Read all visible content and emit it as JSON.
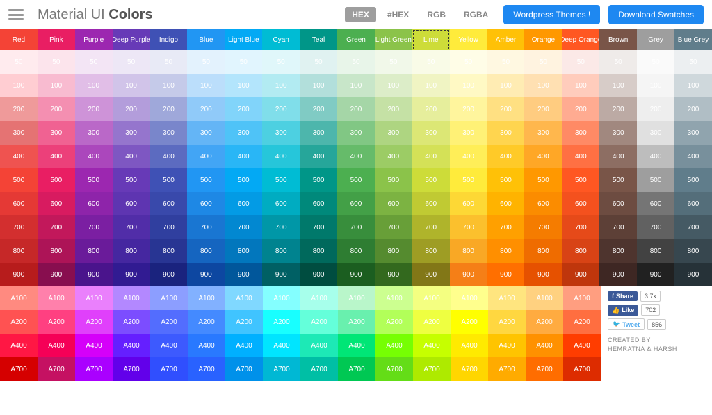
{
  "header": {
    "title_prefix": "Material UI ",
    "title_bold": "Colors",
    "formats": [
      {
        "label": "HEX",
        "active": true
      },
      {
        "label": "#HEX",
        "active": false
      },
      {
        "label": "RGB",
        "active": false
      },
      {
        "label": "RGBA",
        "active": false
      }
    ],
    "wp_button": "Wordpress Themes !",
    "dl_button": "Download Swatches"
  },
  "hues": [
    {
      "name": "Red",
      "shades": {
        "500": "#f44336",
        "50": "#ffebee",
        "100": "#ffcdd2",
        "200": "#ef9a9a",
        "300": "#e57373",
        "400": "#ef5350",
        "600": "#e53935",
        "700": "#d32f2f",
        "800": "#c62828",
        "900": "#b71c1c",
        "A100": "#ff8a80",
        "A200": "#ff5252",
        "A400": "#ff1744",
        "A700": "#d50000"
      }
    },
    {
      "name": "Pink",
      "shades": {
        "500": "#e91e63",
        "50": "#fce4ec",
        "100": "#f8bbd0",
        "200": "#f48fb1",
        "300": "#f06292",
        "400": "#ec407a",
        "600": "#d81b60",
        "700": "#c2185b",
        "800": "#ad1457",
        "900": "#880e4f",
        "A100": "#ff80ab",
        "A200": "#ff4081",
        "A400": "#f50057",
        "A700": "#c51162"
      }
    },
    {
      "name": "Purple",
      "shades": {
        "500": "#9c27b0",
        "50": "#f3e5f5",
        "100": "#e1bee7",
        "200": "#ce93d8",
        "300": "#ba68c8",
        "400": "#ab47bc",
        "600": "#8e24aa",
        "700": "#7b1fa2",
        "800": "#6a1b9a",
        "900": "#4a148c",
        "A100": "#ea80fc",
        "A200": "#e040fb",
        "A400": "#d500f9",
        "A700": "#aa00ff"
      }
    },
    {
      "name": "Deep Purple",
      "shades": {
        "500": "#673ab7",
        "50": "#ede7f6",
        "100": "#d1c4e9",
        "200": "#b39ddb",
        "300": "#9575cd",
        "400": "#7e57c2",
        "600": "#5e35b1",
        "700": "#512da8",
        "800": "#4527a0",
        "900": "#311b92",
        "A100": "#b388ff",
        "A200": "#7c4dff",
        "A400": "#651fff",
        "A700": "#6200ea"
      }
    },
    {
      "name": "Indigo",
      "shades": {
        "500": "#3f51b5",
        "50": "#e8eaf6",
        "100": "#c5cae9",
        "200": "#9fa8da",
        "300": "#7986cb",
        "400": "#5c6bc0",
        "600": "#3949ab",
        "700": "#303f9f",
        "800": "#283593",
        "900": "#1a237e",
        "A100": "#8c9eff",
        "A200": "#536dfe",
        "A400": "#3d5afe",
        "A700": "#304ffe"
      }
    },
    {
      "name": "Blue",
      "shades": {
        "500": "#2196f3",
        "50": "#e3f2fd",
        "100": "#bbdefb",
        "200": "#90caf9",
        "300": "#64b5f6",
        "400": "#42a5f5",
        "600": "#1e88e5",
        "700": "#1976d2",
        "800": "#1565c0",
        "900": "#0d47a1",
        "A100": "#82b1ff",
        "A200": "#448aff",
        "A400": "#2979ff",
        "A700": "#2962ff"
      }
    },
    {
      "name": "Light Blue",
      "shades": {
        "500": "#03a9f4",
        "50": "#e1f5fe",
        "100": "#b3e5fc",
        "200": "#81d4fa",
        "300": "#4fc3f7",
        "400": "#29b6f6",
        "600": "#039be5",
        "700": "#0288d1",
        "800": "#0277bd",
        "900": "#01579b",
        "A100": "#80d8ff",
        "A200": "#40c4ff",
        "A400": "#00b0ff",
        "A700": "#0091ea"
      }
    },
    {
      "name": "Cyan",
      "shades": {
        "500": "#00bcd4",
        "50": "#e0f7fa",
        "100": "#b2ebf2",
        "200": "#80deea",
        "300": "#4dd0e1",
        "400": "#26c6da",
        "600": "#00acc1",
        "700": "#0097a7",
        "800": "#00838f",
        "900": "#006064",
        "A100": "#84ffff",
        "A200": "#18ffff",
        "A400": "#00e5ff",
        "A700": "#00b8d4"
      }
    },
    {
      "name": "Teal",
      "shades": {
        "500": "#009688",
        "50": "#e0f2f1",
        "100": "#b2dfdb",
        "200": "#80cbc4",
        "300": "#4db6ac",
        "400": "#26a69a",
        "600": "#00897b",
        "700": "#00796b",
        "800": "#00695c",
        "900": "#004d40",
        "A100": "#a7ffeb",
        "A200": "#64ffda",
        "A400": "#1de9b6",
        "A700": "#00bfa5"
      }
    },
    {
      "name": "Green",
      "shades": {
        "500": "#4caf50",
        "50": "#e8f5e9",
        "100": "#c8e6c9",
        "200": "#a5d6a7",
        "300": "#81c784",
        "400": "#66bb6a",
        "600": "#43a047",
        "700": "#388e3c",
        "800": "#2e7d32",
        "900": "#1b5e20",
        "A100": "#b9f6ca",
        "A200": "#69f0ae",
        "A400": "#00e676",
        "A700": "#00c853"
      }
    },
    {
      "name": "Light Green",
      "shades": {
        "500": "#8bc34a",
        "50": "#f1f8e9",
        "100": "#dcedc8",
        "200": "#c5e1a5",
        "300": "#aed581",
        "400": "#9ccc65",
        "600": "#7cb342",
        "700": "#689f38",
        "800": "#558b2f",
        "900": "#33691e",
        "A100": "#ccff90",
        "A200": "#b2ff59",
        "A400": "#76ff03",
        "A700": "#64dd17"
      }
    },
    {
      "name": "Lime",
      "selected": true,
      "shades": {
        "500": "#cddc39",
        "50": "#f9fbe7",
        "100": "#f0f4c3",
        "200": "#e6ee9c",
        "300": "#dce775",
        "400": "#d4e157",
        "600": "#c0ca33",
        "700": "#afb42b",
        "800": "#9e9d24",
        "900": "#827717",
        "A100": "#f4ff81",
        "A200": "#eeff41",
        "A400": "#c6ff00",
        "A700": "#aeea00"
      }
    },
    {
      "name": "Yellow",
      "shades": {
        "500": "#ffeb3b",
        "50": "#fffde7",
        "100": "#fff9c4",
        "200": "#fff59d",
        "300": "#fff176",
        "400": "#ffee58",
        "600": "#fdd835",
        "700": "#fbc02d",
        "800": "#f9a825",
        "900": "#f57f17",
        "A100": "#ffff8d",
        "A200": "#ffff00",
        "A400": "#ffea00",
        "A700": "#ffd600"
      }
    },
    {
      "name": "Amber",
      "shades": {
        "500": "#ffc107",
        "50": "#fff8e1",
        "100": "#ffecb3",
        "200": "#ffe082",
        "300": "#ffd54f",
        "400": "#ffca28",
        "600": "#ffb300",
        "700": "#ffa000",
        "800": "#ff8f00",
        "900": "#ff6f00",
        "A100": "#ffe57f",
        "A200": "#ffd740",
        "A400": "#ffc400",
        "A700": "#ffab00"
      }
    },
    {
      "name": "Orange",
      "shades": {
        "500": "#ff9800",
        "50": "#fff3e0",
        "100": "#ffe0b2",
        "200": "#ffcc80",
        "300": "#ffb74d",
        "400": "#ffa726",
        "600": "#fb8c00",
        "700": "#f57c00",
        "800": "#ef6c00",
        "900": "#e65100",
        "A100": "#ffd180",
        "A200": "#ffab40",
        "A400": "#ff9100",
        "A700": "#ff6d00"
      }
    },
    {
      "name": "Deep Orange",
      "shades": {
        "500": "#ff5722",
        "50": "#fbe9e7",
        "100": "#ffccbc",
        "200": "#ffab91",
        "300": "#ff8a65",
        "400": "#ff7043",
        "600": "#f4511e",
        "700": "#e64a19",
        "800": "#d84315",
        "900": "#bf360c",
        "A100": "#ff9e80",
        "A200": "#ff6e40",
        "A400": "#ff3d00",
        "A700": "#dd2c00"
      }
    },
    {
      "name": "Brown",
      "accent": false,
      "shades": {
        "500": "#795548",
        "50": "#efebe9",
        "100": "#d7ccc8",
        "200": "#bcaaa4",
        "300": "#a1887f",
        "400": "#8d6e63",
        "600": "#6d4c41",
        "700": "#5d4037",
        "800": "#4e342e",
        "900": "#3e2723"
      }
    },
    {
      "name": "Grey",
      "accent": false,
      "shades": {
        "500": "#9e9e9e",
        "50": "#fafafa",
        "100": "#f5f5f5",
        "200": "#eeeeee",
        "300": "#e0e0e0",
        "400": "#bdbdbd",
        "600": "#757575",
        "700": "#616161",
        "800": "#424242",
        "900": "#212121"
      }
    },
    {
      "name": "Blue Grey",
      "accent": false,
      "shades": {
        "500": "#607d8b",
        "50": "#eceff1",
        "100": "#cfd8dc",
        "200": "#b0bec5",
        "300": "#90a4ae",
        "400": "#78909c",
        "600": "#546e7a",
        "700": "#455a64",
        "800": "#37474f",
        "900": "#263238"
      }
    }
  ],
  "shade_order": [
    "50",
    "100",
    "200",
    "300",
    "400",
    "500",
    "600",
    "700",
    "800",
    "900"
  ],
  "accent_order": [
    "A100",
    "A200",
    "A400",
    "A700"
  ],
  "social": {
    "share_label": "Share",
    "share_count": "3.7k",
    "like_label": "Like",
    "like_count": "702",
    "tweet_label": "Tweet",
    "tweet_count": "856"
  },
  "credit_line1": "CREATED BY",
  "credit_line2": "HEMRATNA & HARSH"
}
